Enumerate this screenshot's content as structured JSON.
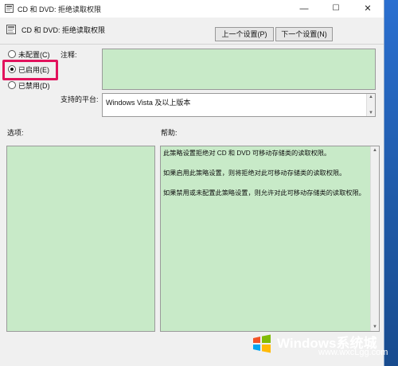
{
  "window": {
    "title": "CD 和 DVD: 拒绝读取权限",
    "controls": {
      "minimize": "—",
      "maximize": "☐",
      "close": "✕"
    }
  },
  "header": {
    "title": "CD 和 DVD: 拒绝读取权限",
    "prev_button": "上一个设置(P)",
    "next_button": "下一个设置(N)"
  },
  "state": {
    "options": [
      {
        "label": "未配置(C)",
        "selected": false
      },
      {
        "label": "已启用(E)",
        "selected": true
      },
      {
        "label": "已禁用(D)",
        "selected": false
      }
    ]
  },
  "comment": {
    "label": "注释:",
    "value": ""
  },
  "platform": {
    "label": "支持的平台:",
    "value": "Windows Vista 及以上版本"
  },
  "options_section": {
    "label": "选项:"
  },
  "help": {
    "label": "帮助:",
    "paragraphs": [
      "此策略设置拒绝对 CD 和 DVD 可移动存储类的读取权限。",
      "如果启用此策略设置，则将拒绝对此可移动存储类的读取权限。",
      "如果禁用或未配置此策略设置，则允许对此可移动存储类的读取权限。"
    ]
  },
  "watermark": {
    "brand": "Windows系统城",
    "site": "www.wxcLgg.com"
  },
  "colors": {
    "panel_green": "#c8eac8",
    "highlight": "#e2135d",
    "desktop": "#1f5aa8"
  }
}
